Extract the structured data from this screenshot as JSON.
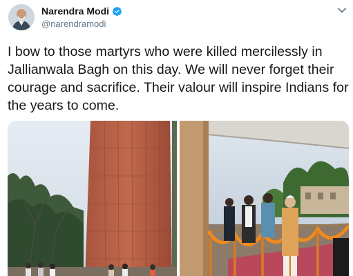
{
  "user": {
    "display_name": "Narendra Modi",
    "handle": "@narendramodi",
    "verified": true,
    "avatar_icon": "profile-avatar"
  },
  "tweet": {
    "text": "I bow to those martyrs who were killed mercilessly in Jallianwala Bagh on this day. We will never forget their courage and sacrifice. Their valour will inspire Indians for the years to come."
  },
  "media": {
    "photos": [
      {
        "icon": "jallianwala-memorial-photo"
      },
      {
        "icon": "wreath-laying-ceremony-photo"
      }
    ]
  },
  "icons": {
    "more": "chevron-down-icon",
    "verified": "verified-badge-icon"
  },
  "colors": {
    "verified_blue": "#1da1f2",
    "text_primary": "#14171a",
    "text_secondary": "#657786"
  }
}
